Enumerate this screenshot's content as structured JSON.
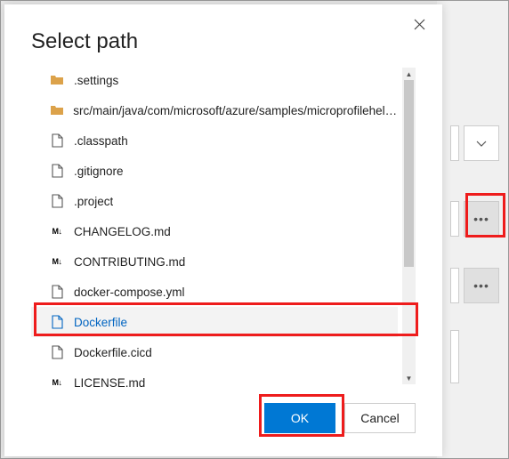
{
  "dialog": {
    "title": "Select path",
    "ok_label": "OK",
    "cancel_label": "Cancel"
  },
  "files": [
    {
      "icon": "folder",
      "name": ".settings"
    },
    {
      "icon": "folder",
      "name": "src/main/java/com/microsoft/azure/samples/microprofilehelloa..."
    },
    {
      "icon": "file",
      "name": ".classpath"
    },
    {
      "icon": "file",
      "name": ".gitignore"
    },
    {
      "icon": "file",
      "name": ".project"
    },
    {
      "icon": "md",
      "name": "CHANGELOG.md"
    },
    {
      "icon": "md",
      "name": "CONTRIBUTING.md"
    },
    {
      "icon": "file",
      "name": "docker-compose.yml"
    },
    {
      "icon": "file",
      "name": "Dockerfile",
      "selected": true
    },
    {
      "icon": "file",
      "name": "Dockerfile.cicd"
    },
    {
      "icon": "md",
      "name": "LICENSE.md"
    }
  ],
  "colors": {
    "primary": "#0078d4",
    "highlight": "#ee1c1c",
    "folder": "#d89c3a"
  }
}
